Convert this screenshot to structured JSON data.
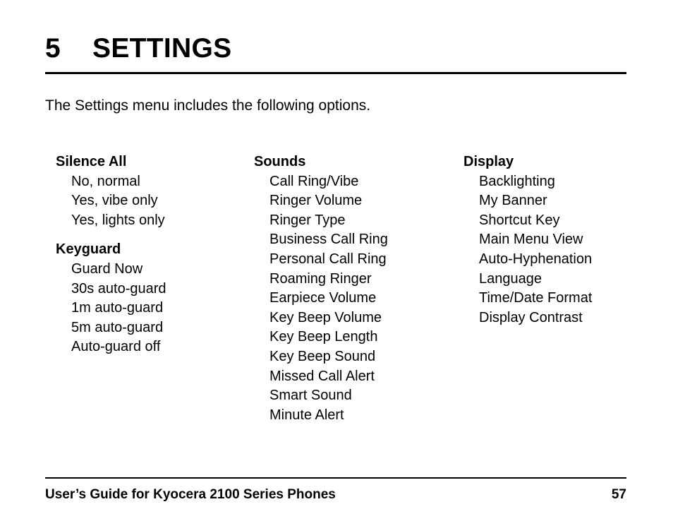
{
  "document": {
    "chapter_number": "5",
    "chapter_title": "SETTINGS",
    "intro": "The Settings menu includes the following options."
  },
  "columns": [
    {
      "name": "column-1",
      "groups": [
        {
          "heading": "Silence All",
          "items": [
            "No, normal",
            "Yes, vibe only",
            "Yes, lights only"
          ]
        },
        {
          "heading": "Keyguard",
          "items": [
            "Guard Now",
            "30s auto-guard",
            "1m auto-guard",
            "5m auto-guard",
            "Auto-guard off"
          ]
        }
      ]
    },
    {
      "name": "column-2",
      "groups": [
        {
          "heading": "Sounds",
          "items": [
            "Call Ring/Vibe",
            "Ringer Volume",
            "Ringer Type",
            "Business Call Ring",
            "Personal Call Ring",
            "Roaming Ringer",
            "Earpiece Volume",
            "Key Beep Volume",
            "Key Beep Length",
            "Key Beep Sound",
            "Missed Call Alert",
            "Smart Sound",
            "Minute Alert"
          ]
        }
      ]
    },
    {
      "name": "column-3",
      "groups": [
        {
          "heading": "Display",
          "items": [
            "Backlighting",
            "My Banner",
            "Shortcut Key",
            "Main Menu View",
            "Auto-Hyphenation",
            "Language",
            "Time/Date Format",
            "Display Contrast"
          ]
        }
      ]
    }
  ],
  "footer": {
    "text": "User’s Guide for Kyocera 2100 Series Phones",
    "page_number": "57"
  },
  "colors": {
    "text": "#000000",
    "background": "#ffffff",
    "rule": "#000000"
  }
}
